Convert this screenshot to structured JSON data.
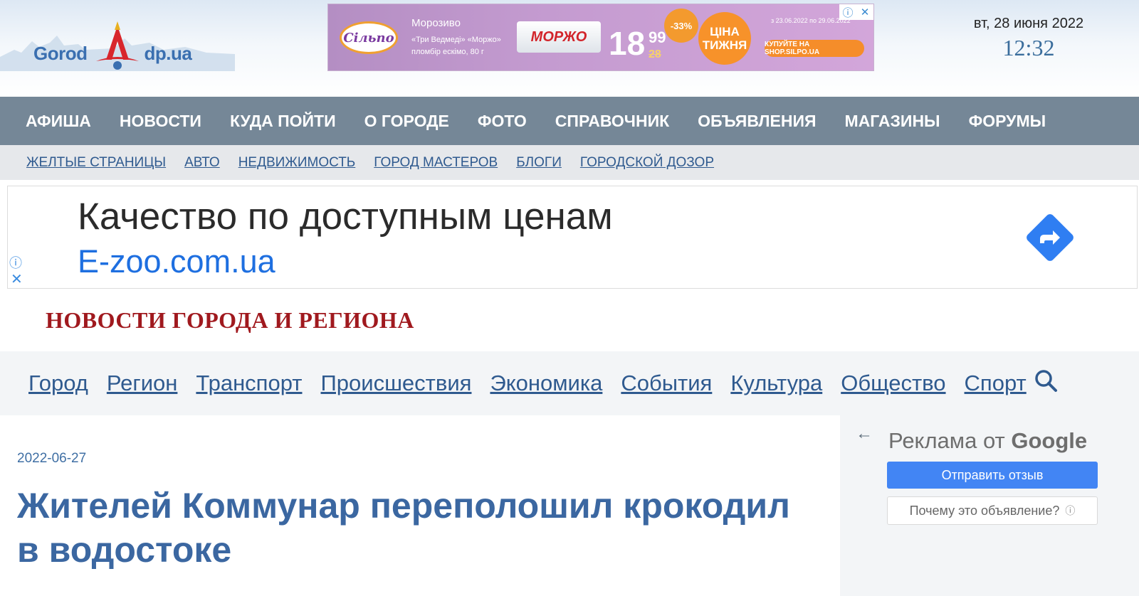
{
  "header": {
    "logo_text_left": "Gorod",
    "logo_text_right": "dp.ua",
    "date": "вт, 28 июня 2022",
    "time": "12:32"
  },
  "top_banner": {
    "brand": "Сільпо",
    "product_name": "Морозиво",
    "product_desc": "«Три Ведмеді» «Моржо» пломбір ескімо, 80 г",
    "pack_label": "МОРЖО",
    "price_main": "18",
    "price_cents": "99",
    "price_old": "28",
    "discount": "-33%",
    "promo": "ЦІНА ТИЖНЯ",
    "dates": "з 23.06.2022 по 29.06.2022",
    "cta": "КУПУЙТЕ НА SHOP.SILPO.UA",
    "accent_color": "#c49bd0"
  },
  "main_nav": {
    "items": [
      "АФИША",
      "НОВОСТИ",
      "КУДА ПОЙТИ",
      "О ГОРОДЕ",
      "ФОТО",
      "СПРАВОЧНИК",
      "ОБЪЯВЛЕНИЯ",
      "МАГАЗИНЫ",
      "ФОРУМЫ"
    ]
  },
  "sub_nav": {
    "items": [
      "ЖЕЛТЫЕ СТРАНИЦЫ",
      "АВТО",
      "НЕДВИЖИМОСТЬ",
      "ГОРОД МАСТЕРОВ",
      "БЛОГИ",
      "ГОРОДСКОЙ ДОЗОР"
    ]
  },
  "ad_block": {
    "headline": "Качество по доступным ценам",
    "url": "E-zoo.com.ua",
    "info_icon": "info-icon",
    "close_icon": "close-icon"
  },
  "section": {
    "title": "НОВОСТИ ГОРОДА И РЕГИОНА"
  },
  "category_nav": {
    "items": [
      "Город",
      "Регион",
      "Транспорт",
      "Происшествия",
      "Экономика",
      "События",
      "Культура",
      "Общество",
      "Спорт"
    ],
    "search_icon": "search-icon"
  },
  "article": {
    "date": "2022-06-27",
    "title": "Жителей Коммунар переполошил крокодил в водостоке"
  },
  "sidebar": {
    "title_prefix": "Реклама от",
    "title_brand": "Google",
    "send_button": "Отправить отзыв",
    "why_button": "Почему это объявление?"
  }
}
